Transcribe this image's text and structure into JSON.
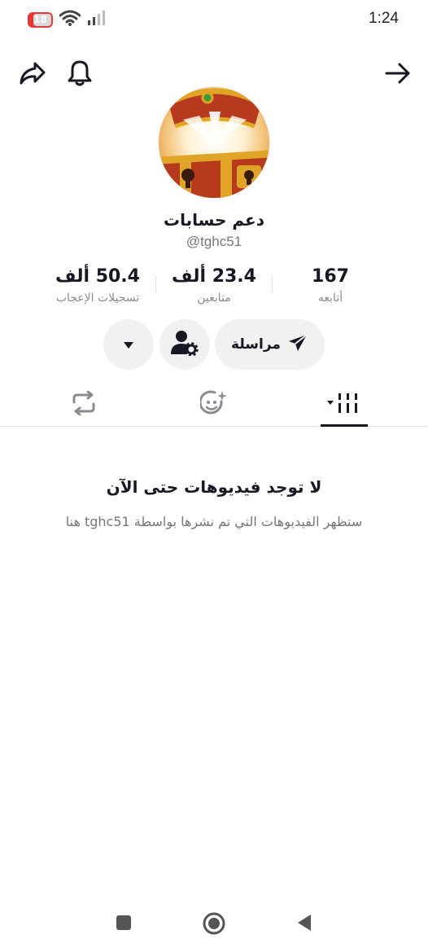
{
  "status_bar": {
    "battery_level": "18",
    "time": "1:24",
    "icons": [
      "battery-icon",
      "wifi-icon",
      "signal-icon"
    ]
  },
  "top_nav": {
    "icons": [
      "share-icon",
      "bell-icon",
      "arrow-right-icon"
    ]
  },
  "profile": {
    "display_name": "دعم حسابات",
    "username": "@tghc51",
    "avatar_icon": "treasure-chest-avatar"
  },
  "stats": {
    "following": {
      "value": "167",
      "label": "أتابعه"
    },
    "followers": {
      "value": "23.4 ألف",
      "label": "متابعين"
    },
    "likes": {
      "value": "50.4 ألف",
      "label": "تسجيلات الإعجاب"
    }
  },
  "actions": {
    "message_label": "مراسلة",
    "message_icon": "send-icon",
    "friends_icon": "user-settings-icon",
    "more_icon": "caret-down-icon"
  },
  "tabs": [
    {
      "icon": "videos-grid-icon",
      "active": true
    },
    {
      "icon": "sparkle-face-icon",
      "active": false
    },
    {
      "icon": "repost-icon",
      "active": false
    }
  ],
  "empty_state": {
    "title": "لا توجد فيديوهات حتى الآن",
    "subtitle": "ستظهر الفيديوهات التي تم نشرها بواسطة tghc51 هنا"
  },
  "system_nav": {
    "icons": [
      "recents-icon",
      "home-icon",
      "back-icon"
    ]
  },
  "colors": {
    "text_primary": "#161823",
    "text_secondary": "#75767c",
    "pill_bg": "#f1f1f2",
    "battery_red": "#e53935"
  }
}
